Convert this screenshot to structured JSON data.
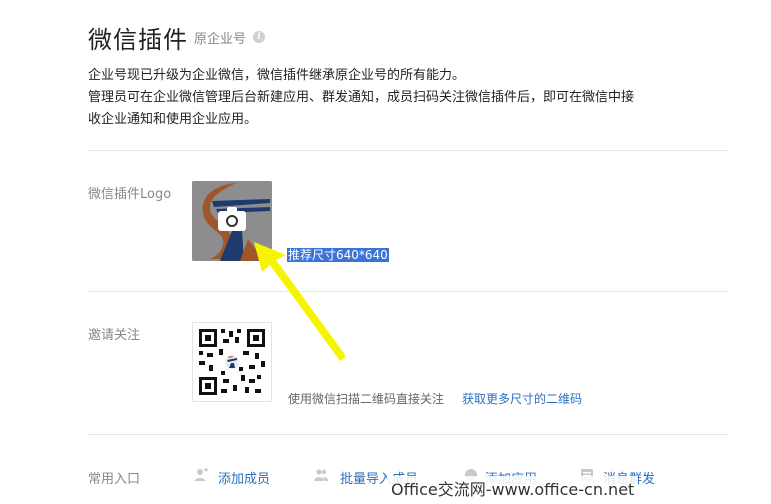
{
  "header": {
    "title": "微信插件",
    "subtitle": "原企业号"
  },
  "description": {
    "line1": "企业号现已升级为企业微信，微信插件继承原企业号的所有能力。",
    "line2": "管理员可在企业微信管理后台新建应用、群发通知，成员扫码关注微信插件后，即可在微信中接",
    "line3": "收企业通知和使用企业应用。"
  },
  "logo_section": {
    "label": "微信插件Logo",
    "hint": "推荐尺寸640*640"
  },
  "qr_section": {
    "label": "邀请关注",
    "caption": "使用微信扫描二维码直接关注",
    "link": "获取更多尺寸的二维码"
  },
  "shortcuts": {
    "label": "常用入口",
    "items": [
      {
        "label": "添加成员",
        "icon": "add-user-icon"
      },
      {
        "label": "批量导入成员",
        "icon": "users-icon"
      },
      {
        "label": "添加应用",
        "icon": "app-icon"
      },
      {
        "label": "消息群发",
        "icon": "message-icon"
      }
    ]
  },
  "watermark": "Office交流网-www.office-cn.net",
  "colors": {
    "link": "#2c6fbf",
    "selection": "#3a74d6",
    "arrow": "#f5f500"
  }
}
